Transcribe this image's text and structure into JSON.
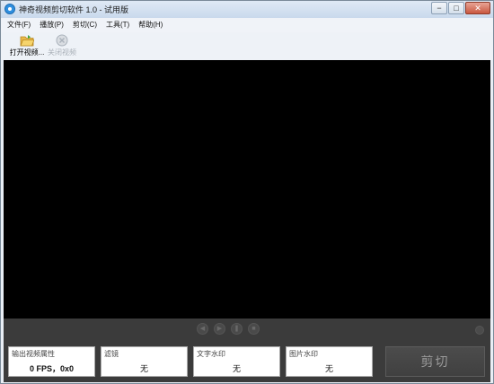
{
  "window": {
    "title": "神奇视频剪切软件 1.0 - 试用版",
    "controls": [
      "−",
      "□",
      "✕"
    ]
  },
  "menu": [
    "文件(F)",
    "播放(P)",
    "剪切(C)",
    "工具(T)",
    "帮助(H)"
  ],
  "toolbar": {
    "open_label": "打开视频...",
    "close_label": "关闭视频"
  },
  "player_controls": [
    {
      "icon": "rewind-icon",
      "glyph": "◀"
    },
    {
      "icon": "play-icon",
      "glyph": "▶"
    },
    {
      "icon": "pause-icon",
      "glyph": "❚"
    },
    {
      "icon": "stop-icon",
      "glyph": "■"
    }
  ],
  "output_props": {
    "caption": "输出视频属性",
    "value": "0 FPS，0x0"
  },
  "filter": {
    "caption": "滤镜",
    "value": "无"
  },
  "text_watermark": {
    "caption": "文字水印",
    "value": "无"
  },
  "image_watermark": {
    "caption": "图片水印",
    "value": "无"
  },
  "cut_label": "剪切",
  "colors": {
    "video_bg": "#000000",
    "panel_bg": "#3b3b3b",
    "titlebar": "#c9d9ec"
  }
}
